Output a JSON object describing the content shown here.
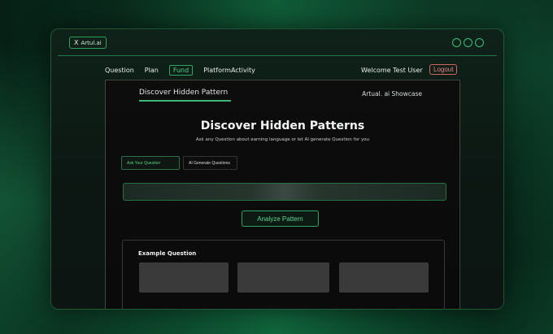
{
  "app": {
    "logo_mark": "X",
    "logo_text": "Artul.ai"
  },
  "nav": {
    "items": [
      {
        "label": "Question",
        "active": false
      },
      {
        "label": "Plan",
        "active": false
      },
      {
        "label": "Fund",
        "active": true
      },
      {
        "label": "PlatformActivity",
        "active": false
      }
    ],
    "welcome": "Welcome Test User",
    "logout": "Logout"
  },
  "panel": {
    "tab": "Discover Hidden Pattern",
    "showcase": "Artual. ai Showcase"
  },
  "hero": {
    "title": "Discover Hidden Patterns",
    "subtitle": "Ask any Question about earning language or let AI generate Question for you"
  },
  "modes": {
    "ask": "Ask Your Question",
    "generate": "AI Generate Questions"
  },
  "input": {
    "value": "",
    "placeholder": ""
  },
  "analyze": "Analyze Pattern",
  "examples": {
    "title": "Example Question",
    "cards": [
      "",
      "",
      ""
    ]
  },
  "colors": {
    "accent": "#3fb877",
    "logout": "#d36464",
    "panel_bg": "#0a0a0a"
  },
  "icons": {
    "logo": "x-logo-icon",
    "window_controls": [
      "circle-icon",
      "circle-icon",
      "circle-icon"
    ]
  }
}
